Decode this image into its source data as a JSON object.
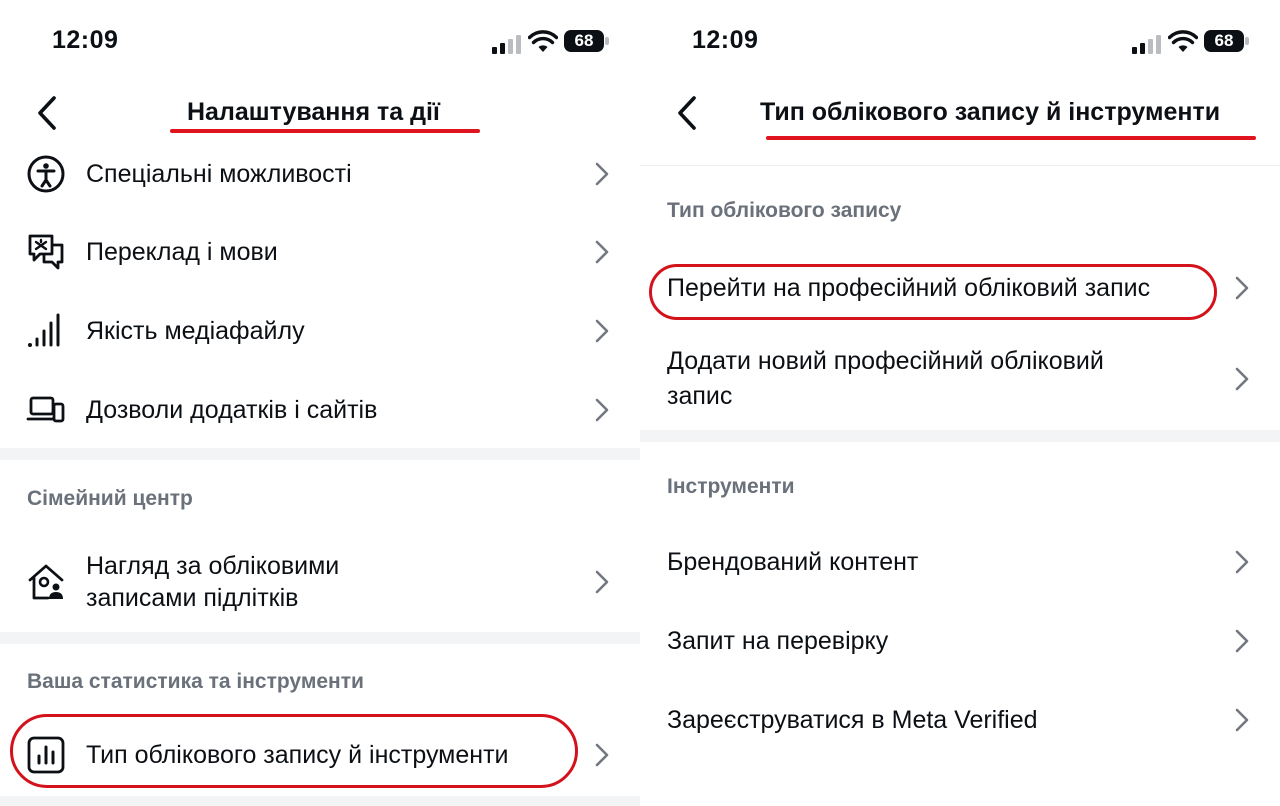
{
  "left": {
    "status": {
      "time": "12:09",
      "battery": "68"
    },
    "header": {
      "title": "Налаштування та дії"
    },
    "items_top": [
      {
        "icon": "accessibility-icon",
        "label": "Спеціальні можливості"
      },
      {
        "icon": "translate-icon",
        "label": "Переклад і мови"
      },
      {
        "icon": "signal-bars-icon",
        "label": "Якість медіафайлу"
      },
      {
        "icon": "laptop-phone-icon",
        "label": "Дозволи додатків і сайтів"
      }
    ],
    "family_section": {
      "heading": "Сімейний центр",
      "item": {
        "icon": "family-home-icon",
        "line1": "Нагляд за обліковими",
        "line2": "записами підлітків"
      }
    },
    "stats_section": {
      "heading": "Ваша статистика та інструменти",
      "item": {
        "icon": "bar-chart-icon",
        "label": "Тип облікового запису й інструменти"
      }
    }
  },
  "right": {
    "status": {
      "time": "12:09",
      "battery": "68"
    },
    "header": {
      "title": "Тип облікового запису й інструменти"
    },
    "account_section": {
      "heading": "Тип облікового запису",
      "items": [
        {
          "label": "Перейти на професійний обліковий запис"
        },
        {
          "line1": "Додати новий професійний обліковий",
          "line2": "запис"
        }
      ]
    },
    "tools_section": {
      "heading": "Інструменти",
      "items": [
        {
          "label": "Брендований контент"
        },
        {
          "label": "Запит на перевірку"
        },
        {
          "label": "Зареєструватися в Meta Verified"
        }
      ]
    }
  },
  "colors": {
    "highlight": "#d4121c",
    "section_text": "#6a717a",
    "divider": "#f3f4f5"
  }
}
